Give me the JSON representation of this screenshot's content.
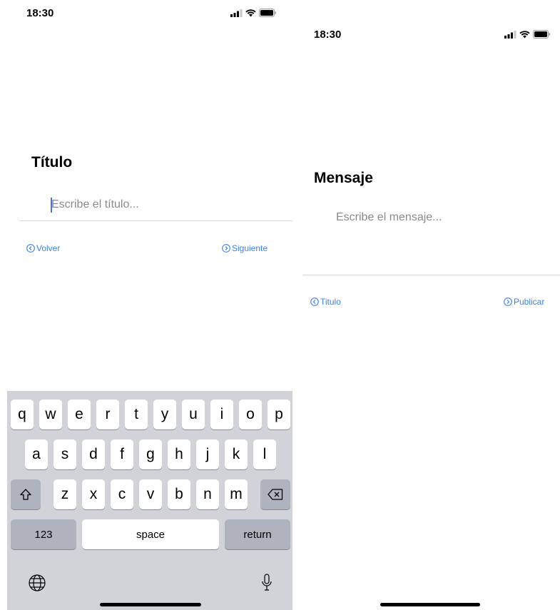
{
  "left_screen": {
    "status": {
      "time": "18:30"
    },
    "title": "Título",
    "input": {
      "placeholder": "Escribe el título..."
    },
    "back_button": {
      "label": "Volver"
    },
    "next_button": {
      "label": "Siguiente"
    },
    "keyboard": {
      "row1": [
        "q",
        "w",
        "e",
        "r",
        "t",
        "y",
        "u",
        "i",
        "o",
        "p"
      ],
      "row2": [
        "a",
        "s",
        "d",
        "f",
        "g",
        "h",
        "j",
        "k",
        "l"
      ],
      "row3": [
        "z",
        "x",
        "c",
        "v",
        "b",
        "n",
        "m"
      ],
      "numbers_label": "123",
      "space_label": "space",
      "return_label": "return"
    }
  },
  "right_screen": {
    "status": {
      "time": "18:30"
    },
    "title": "Mensaje",
    "input": {
      "placeholder": "Escribe el mensaje..."
    },
    "back_button": {
      "label": "Titulo"
    },
    "next_button": {
      "label": "Publicar"
    }
  },
  "colors": {
    "accent": "#3a82f6",
    "caret": "#4a74d6",
    "keyboard_bg": "#d1d3d9"
  }
}
